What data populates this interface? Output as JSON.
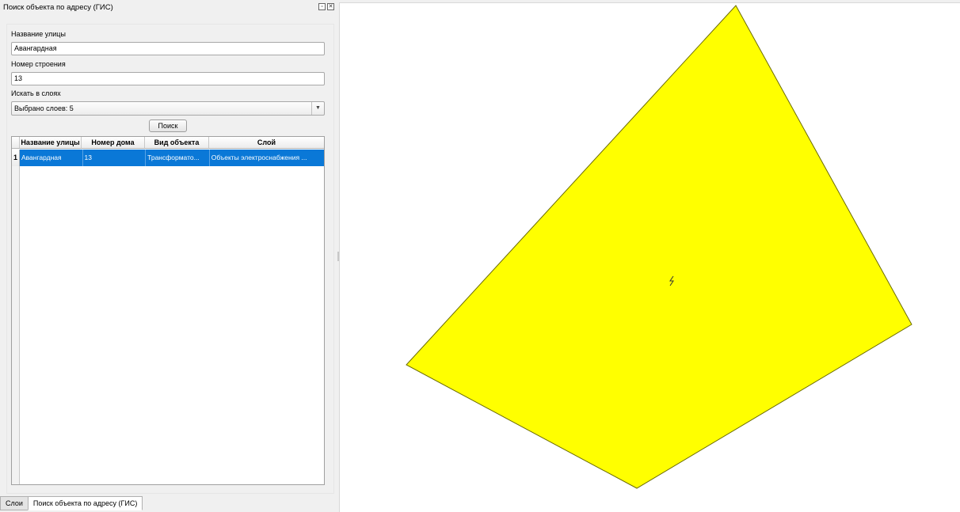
{
  "dock": {
    "title": "Поиск объекта по адресу (ГИС)",
    "float_icon": "float-icon",
    "close_icon": "close-icon"
  },
  "form": {
    "street_label": "Название улицы",
    "street_value": "Авангардная",
    "building_label": "Номер строения",
    "building_value": "13",
    "layers_label": "Искать в слоях",
    "layers_value": "Выбрано слоев: 5",
    "search_button": "Поиск"
  },
  "table": {
    "headers": [
      "Название улицы",
      "Номер дома",
      "Вид объекта",
      "Слой"
    ],
    "rows": [
      {
        "num": "1",
        "cells": [
          "Авангардная",
          "13",
          "Трансформато...",
          "Объекты электроснабжения ..."
        ]
      }
    ]
  },
  "tabs": [
    {
      "label": "Слои",
      "active": false
    },
    {
      "label": "Поиск объекта по адресу (ГИС)",
      "active": true
    }
  ],
  "map": {
    "feature_fill": "#ffff00",
    "feature_stroke": "#6b6b00",
    "marker_icon": "lightning-icon"
  }
}
